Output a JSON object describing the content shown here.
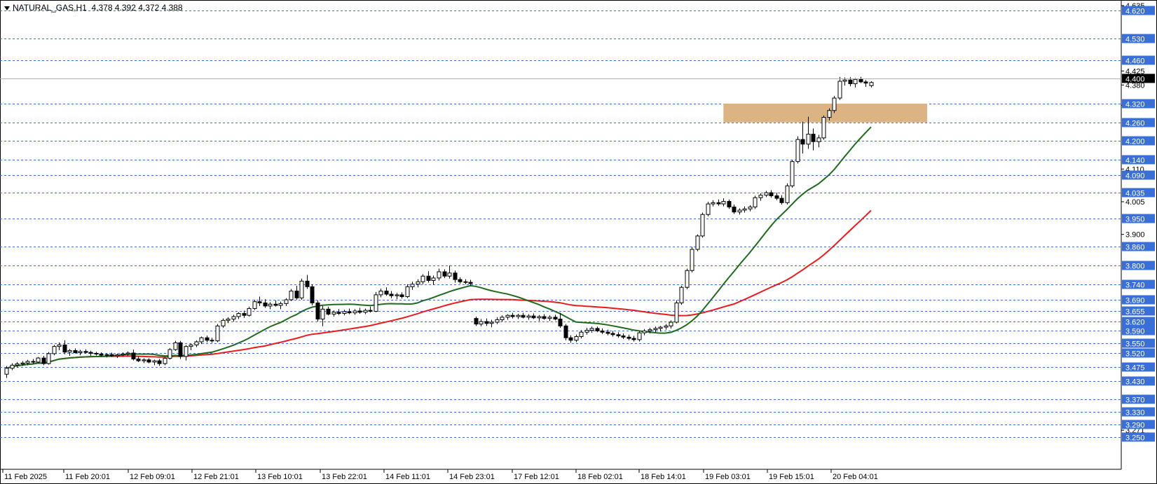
{
  "header": {
    "symbol": "NATURAL_GAS,H1",
    "ohlc": "4.378 4.392 4.372 4.388"
  },
  "colors": {
    "level_line": "#3a6fd8",
    "level_label_bg": "#3a6fd8",
    "level_label_text": "#ffffff",
    "price_label_bg": "#000000",
    "zone_fill": "#dcb483",
    "ma_fast": "#1e6b1e",
    "ma_slow": "#e81c1c",
    "candle_bull": "#ffffff",
    "candle_bear": "#000000"
  },
  "chart_data": {
    "type": "candlestick",
    "ylim": [
      3.231,
      4.635
    ],
    "axis_ticks": [
      "4.635",
      "4.425",
      "4.380",
      "4.315",
      "4.110",
      "4.005",
      "3.900",
      "3.271"
    ],
    "levels": [
      "4.620",
      "4.530",
      "4.460",
      "4.320",
      "4.260",
      "4.200",
      "4.140",
      "4.090",
      "4.035",
      "3.950",
      "3.860",
      "3.800",
      "3.740",
      "3.690",
      "3.655",
      "3.620",
      "3.590",
      "3.550",
      "3.520",
      "3.475",
      "3.430",
      "3.370",
      "3.330",
      "3.290",
      "3.250"
    ],
    "current_price": "4.400",
    "zone": {
      "from": 4.26,
      "to": 4.32
    },
    "x_labels": [
      "11 Feb 2025",
      "11 Feb 20:01",
      "12 Feb 09:01",
      "12 Feb 21:01",
      "13 Feb 10:01",
      "13 Feb 22:01",
      "14 Feb 11:01",
      "14 Feb 23:01",
      "17 Feb 12:01",
      "18 Feb 02:01",
      "18 Feb 14:01",
      "19 Feb 03:01",
      "19 Feb 15:01",
      "20 Feb 04:01"
    ],
    "candles": [
      [
        3.451,
        3.477,
        3.439,
        3.47
      ],
      [
        3.47,
        3.486,
        3.464,
        3.48
      ],
      [
        3.48,
        3.49,
        3.472,
        3.484
      ],
      [
        3.484,
        3.493,
        3.478,
        3.487
      ],
      [
        3.487,
        3.497,
        3.48,
        3.492
      ],
      [
        3.492,
        3.5,
        3.484,
        3.49
      ],
      [
        3.49,
        3.506,
        3.486,
        3.503
      ],
      [
        3.503,
        3.51,
        3.48,
        3.485
      ],
      [
        3.485,
        3.522,
        3.482,
        3.517
      ],
      [
        3.517,
        3.545,
        3.512,
        3.54
      ],
      [
        3.54,
        3.553,
        3.528,
        3.545
      ],
      [
        3.545,
        3.56,
        3.515,
        3.522
      ],
      [
        3.522,
        3.532,
        3.51,
        3.527
      ],
      [
        3.527,
        3.534,
        3.518,
        3.52
      ],
      [
        3.52,
        3.529,
        3.512,
        3.524
      ],
      [
        3.524,
        3.531,
        3.517,
        3.521
      ],
      [
        3.521,
        3.526,
        3.51,
        3.518
      ],
      [
        3.518,
        3.523,
        3.511,
        3.516
      ],
      [
        3.516,
        3.521,
        3.508,
        3.512
      ],
      [
        3.512,
        3.518,
        3.505,
        3.514
      ],
      [
        3.514,
        3.52,
        3.507,
        3.51
      ],
      [
        3.51,
        3.517,
        3.503,
        3.513
      ],
      [
        3.513,
        3.521,
        3.507,
        3.516
      ],
      [
        3.516,
        3.524,
        3.509,
        3.519
      ],
      [
        3.519,
        3.53,
        3.495,
        3.5
      ],
      [
        3.5,
        3.508,
        3.49,
        3.494
      ],
      [
        3.494,
        3.502,
        3.487,
        3.497
      ],
      [
        3.497,
        3.502,
        3.486,
        3.49
      ],
      [
        3.49,
        3.498,
        3.48,
        3.494
      ],
      [
        3.494,
        3.5,
        3.478,
        3.485
      ],
      [
        3.485,
        3.506,
        3.48,
        3.502
      ],
      [
        3.502,
        3.535,
        3.498,
        3.53
      ],
      [
        3.53,
        3.558,
        3.526,
        3.552
      ],
      [
        3.552,
        3.558,
        3.5,
        3.508
      ],
      [
        3.508,
        3.545,
        3.495,
        3.54
      ],
      [
        3.54,
        3.55,
        3.528,
        3.545
      ],
      [
        3.545,
        3.56,
        3.538,
        3.555
      ],
      [
        3.555,
        3.572,
        3.548,
        3.568
      ],
      [
        3.568,
        3.575,
        3.553,
        3.56
      ],
      [
        3.56,
        3.568,
        3.552,
        3.558
      ],
      [
        3.558,
        3.612,
        3.554,
        3.606
      ],
      [
        3.606,
        3.63,
        3.6,
        3.624
      ],
      [
        3.624,
        3.634,
        3.615,
        3.628
      ],
      [
        3.628,
        3.642,
        3.62,
        3.636
      ],
      [
        3.636,
        3.65,
        3.628,
        3.646
      ],
      [
        3.646,
        3.655,
        3.632,
        3.64
      ],
      [
        3.64,
        3.668,
        3.636,
        3.662
      ],
      [
        3.662,
        3.69,
        3.657,
        3.684
      ],
      [
        3.684,
        3.7,
        3.67,
        3.68
      ],
      [
        3.68,
        3.692,
        3.664,
        3.67
      ],
      [
        3.67,
        3.682,
        3.66,
        3.676
      ],
      [
        3.676,
        3.688,
        3.668,
        3.672
      ],
      [
        3.672,
        3.684,
        3.66,
        3.678
      ],
      [
        3.678,
        3.695,
        3.67,
        3.69
      ],
      [
        3.69,
        3.725,
        3.686,
        3.718
      ],
      [
        3.718,
        3.735,
        3.69,
        3.696
      ],
      [
        3.696,
        3.758,
        3.69,
        3.75
      ],
      [
        3.75,
        3.77,
        3.725,
        3.732
      ],
      [
        3.732,
        3.74,
        3.672,
        3.68
      ],
      [
        3.68,
        3.688,
        3.62,
        3.628
      ],
      [
        3.628,
        3.67,
        3.605,
        3.66
      ],
      [
        3.66,
        3.668,
        3.64,
        3.644
      ],
      [
        3.644,
        3.656,
        3.636,
        3.65
      ],
      [
        3.65,
        3.66,
        3.641,
        3.646
      ],
      [
        3.646,
        3.658,
        3.64,
        3.652
      ],
      [
        3.652,
        3.662,
        3.644,
        3.648
      ],
      [
        3.648,
        3.66,
        3.642,
        3.654
      ],
      [
        3.654,
        3.664,
        3.645,
        3.65
      ],
      [
        3.65,
        3.662,
        3.644,
        3.656
      ],
      [
        3.656,
        3.668,
        3.649,
        3.653
      ],
      [
        3.653,
        3.715,
        3.65,
        3.706
      ],
      [
        3.706,
        3.726,
        3.698,
        3.718
      ],
      [
        3.718,
        3.73,
        3.703,
        3.708
      ],
      [
        3.708,
        3.718,
        3.695,
        3.703
      ],
      [
        3.703,
        3.712,
        3.692,
        3.706
      ],
      [
        3.706,
        3.714,
        3.694,
        3.7
      ],
      [
        3.7,
        3.74,
        3.696,
        3.732
      ],
      [
        3.732,
        3.748,
        3.722,
        3.74
      ],
      [
        3.74,
        3.756,
        3.73,
        3.748
      ],
      [
        3.748,
        3.772,
        3.74,
        3.766
      ],
      [
        3.766,
        3.782,
        3.745,
        3.752
      ],
      [
        3.752,
        3.768,
        3.738,
        3.76
      ],
      [
        3.76,
        3.79,
        3.752,
        3.78
      ],
      [
        3.78,
        3.788,
        3.76,
        3.766
      ],
      [
        3.766,
        3.8,
        3.758,
        3.776
      ],
      [
        3.776,
        3.784,
        3.745,
        3.755
      ],
      [
        3.755,
        3.762,
        3.742,
        3.748
      ],
      [
        3.748,
        3.756,
        3.74,
        3.746
      ],
      [
        3.746,
        3.754,
        3.736,
        3.742
      ],
      [
        3.63,
        3.636,
        3.606,
        3.612
      ],
      [
        3.612,
        3.628,
        3.605,
        3.62
      ],
      [
        3.62,
        3.63,
        3.606,
        3.614
      ],
      [
        3.614,
        3.626,
        3.602,
        3.618
      ],
      [
        3.618,
        3.634,
        3.612,
        3.626
      ],
      [
        3.626,
        3.64,
        3.62,
        3.634
      ],
      [
        3.634,
        3.644,
        3.626,
        3.64
      ],
      [
        3.64,
        3.648,
        3.63,
        3.636
      ],
      [
        3.636,
        3.645,
        3.628,
        3.64
      ],
      [
        3.64,
        3.648,
        3.63,
        3.634
      ],
      [
        3.634,
        3.644,
        3.626,
        3.638
      ],
      [
        3.638,
        3.646,
        3.628,
        3.632
      ],
      [
        3.632,
        3.641,
        3.622,
        3.636
      ],
      [
        3.636,
        3.644,
        3.626,
        3.63
      ],
      [
        3.63,
        3.64,
        3.622,
        3.634
      ],
      [
        3.634,
        3.642,
        3.624,
        3.628
      ],
      [
        3.628,
        3.648,
        3.6,
        3.606
      ],
      [
        3.606,
        3.612,
        3.56,
        3.568
      ],
      [
        3.568,
        3.576,
        3.552,
        3.56
      ],
      [
        3.56,
        3.578,
        3.554,
        3.572
      ],
      [
        3.572,
        3.592,
        3.566,
        3.586
      ],
      [
        3.586,
        3.6,
        3.578,
        3.592
      ],
      [
        3.592,
        3.604,
        3.584,
        3.598
      ],
      [
        3.598,
        3.604,
        3.586,
        3.59
      ],
      [
        3.59,
        3.598,
        3.58,
        3.586
      ],
      [
        3.586,
        3.594,
        3.576,
        3.582
      ],
      [
        3.582,
        3.59,
        3.572,
        3.578
      ],
      [
        3.578,
        3.586,
        3.568,
        3.574
      ],
      [
        3.574,
        3.582,
        3.564,
        3.57
      ],
      [
        3.57,
        3.578,
        3.56,
        3.566
      ],
      [
        3.566,
        3.574,
        3.556,
        3.562
      ],
      [
        3.562,
        3.59,
        3.556,
        3.584
      ],
      [
        3.584,
        3.596,
        3.576,
        3.59
      ],
      [
        3.59,
        3.6,
        3.582,
        3.594
      ],
      [
        3.594,
        3.604,
        3.586,
        3.598
      ],
      [
        3.598,
        3.606,
        3.588,
        3.602
      ],
      [
        3.602,
        3.612,
        3.594,
        3.606
      ],
      [
        3.606,
        3.624,
        3.598,
        3.618
      ],
      [
        3.618,
        3.688,
        3.614,
        3.68
      ],
      [
        3.68,
        3.735,
        3.674,
        3.73
      ],
      [
        3.73,
        3.79,
        3.724,
        3.784
      ],
      [
        3.784,
        3.86,
        3.778,
        3.852
      ],
      [
        3.852,
        3.9,
        3.846,
        3.895
      ],
      [
        3.895,
        3.97,
        3.89,
        3.964
      ],
      [
        3.964,
        4.005,
        3.958,
        3.998
      ],
      [
        3.998,
        4.01,
        3.99,
        4.002
      ],
      [
        4.002,
        4.012,
        3.992,
        3.998
      ],
      [
        3.998,
        4.016,
        3.99,
        4.006
      ],
      [
        4.006,
        4.012,
        3.982,
        3.988
      ],
      [
        3.988,
        3.996,
        3.966,
        3.972
      ],
      [
        3.972,
        3.984,
        3.964,
        3.978
      ],
      [
        3.978,
        3.99,
        3.97,
        3.982
      ],
      [
        3.982,
        3.994,
        3.974,
        3.988
      ],
      [
        3.988,
        4.024,
        3.982,
        4.018
      ],
      [
        4.018,
        4.032,
        4.008,
        4.026
      ],
      [
        4.026,
        4.04,
        4.02,
        4.034
      ],
      [
        4.034,
        4.042,
        4.018,
        4.024
      ],
      [
        4.024,
        4.034,
        4.01,
        4.016
      ],
      [
        4.016,
        4.026,
        3.996,
        4.002
      ],
      [
        4.002,
        4.064,
        3.996,
        4.056
      ],
      [
        4.056,
        4.14,
        4.05,
        4.134
      ],
      [
        4.134,
        4.215,
        4.128,
        4.205
      ],
      [
        4.205,
        4.262,
        4.16,
        4.19
      ],
      [
        4.19,
        4.278,
        4.175,
        4.222
      ],
      [
        4.222,
        4.24,
        4.17,
        4.198
      ],
      [
        4.198,
        4.22,
        4.18,
        4.21
      ],
      [
        4.21,
        4.282,
        4.204,
        4.276
      ],
      [
        4.276,
        4.305,
        4.266,
        4.298
      ],
      [
        4.298,
        4.345,
        4.29,
        4.338
      ],
      [
        4.338,
        4.406,
        4.332,
        4.392
      ],
      [
        4.392,
        4.404,
        4.378,
        4.396
      ],
      [
        4.396,
        4.405,
        4.376,
        4.384
      ],
      [
        4.384,
        4.402,
        4.372,
        4.398
      ],
      [
        4.398,
        4.406,
        4.386,
        4.39
      ],
      [
        4.39,
        4.396,
        4.374,
        4.386
      ],
      [
        4.378,
        4.392,
        4.372,
        4.388
      ]
    ]
  }
}
